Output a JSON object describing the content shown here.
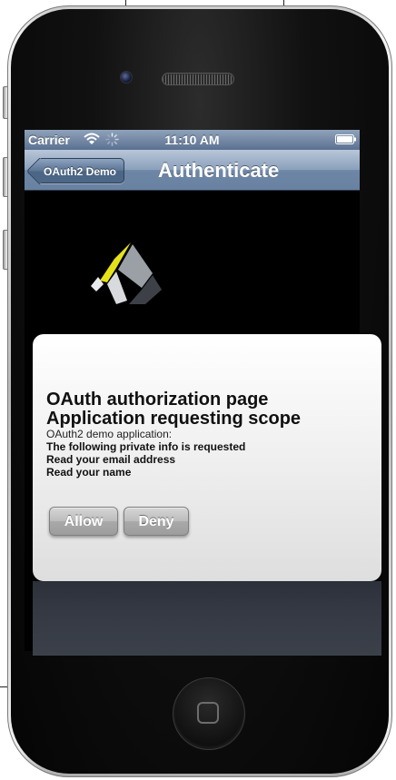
{
  "status_bar": {
    "carrier": "Carrier",
    "time": "11:10 AM",
    "icons": [
      "wifi-icon",
      "activity-spinner-icon",
      "battery-icon"
    ]
  },
  "nav_bar": {
    "back_label": "OAuth2 Demo",
    "title": "Authenticate"
  },
  "logo": {
    "icon": "brand-logo",
    "colors": {
      "yellow": "#e5e21a",
      "gray": "#9aa0a6",
      "dark": "#3d4147"
    }
  },
  "dialog": {
    "heading_line1": "OAuth authorization page",
    "heading_line2": "Application requesting scope",
    "app_line": "OAuth2 demo application:",
    "info_lines": [
      "The following private info is requested",
      "Read your email address",
      "Read your name"
    ],
    "allow_label": "Allow",
    "deny_label": "Deny"
  },
  "colors": {
    "nav_bar": "#6d86a6",
    "screen_background": "#000000",
    "dialog_background": "#f1f1f1",
    "button_gray": "#a9a9a9"
  }
}
